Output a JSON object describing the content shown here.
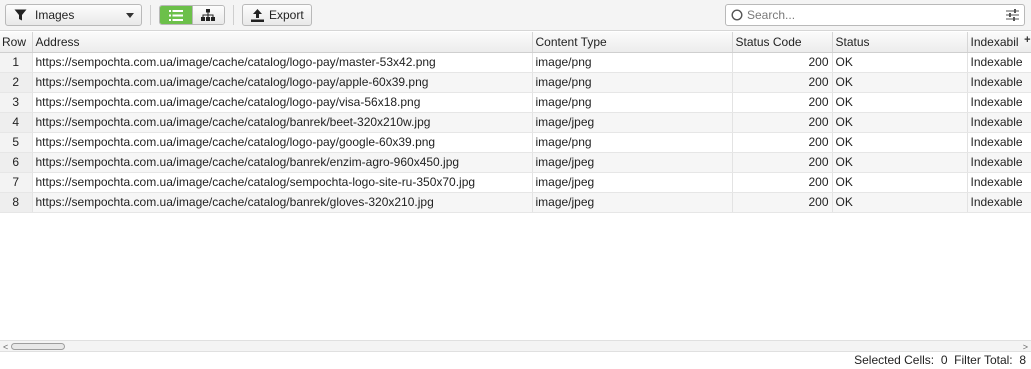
{
  "toolbar": {
    "filter": {
      "selected": "Images"
    },
    "view_toggle": {
      "icons": [
        "list-view-icon",
        "tree-view-icon"
      ],
      "active": "list-view-icon"
    },
    "export_label": "Export",
    "search": {
      "placeholder": "Search...",
      "value": ""
    }
  },
  "table": {
    "columns": [
      "Row",
      "Address",
      "Content Type",
      "Status Code",
      "Status",
      "Indexabil"
    ],
    "rows": [
      {
        "row": "1",
        "address": "https://sempochta.com.ua/image/cache/catalog/logo-pay/master-53x42.png",
        "content_type": "image/png",
        "status_code": "200",
        "status": "OK",
        "indexability": "Indexable"
      },
      {
        "row": "2",
        "address": "https://sempochta.com.ua/image/cache/catalog/logo-pay/apple-60x39.png",
        "content_type": "image/png",
        "status_code": "200",
        "status": "OK",
        "indexability": "Indexable"
      },
      {
        "row": "3",
        "address": "https://sempochta.com.ua/image/cache/catalog/logo-pay/visa-56x18.png",
        "content_type": "image/png",
        "status_code": "200",
        "status": "OK",
        "indexability": "Indexable"
      },
      {
        "row": "4",
        "address": "https://sempochta.com.ua/image/cache/catalog/banrek/beet-320x210w.jpg",
        "content_type": "image/jpeg",
        "status_code": "200",
        "status": "OK",
        "indexability": "Indexable"
      },
      {
        "row": "5",
        "address": "https://sempochta.com.ua/image/cache/catalog/logo-pay/google-60x39.png",
        "content_type": "image/png",
        "status_code": "200",
        "status": "OK",
        "indexability": "Indexable"
      },
      {
        "row": "6",
        "address": "https://sempochta.com.ua/image/cache/catalog/banrek/enzim-agro-960x450.jpg",
        "content_type": "image/jpeg",
        "status_code": "200",
        "status": "OK",
        "indexability": "Indexable"
      },
      {
        "row": "7",
        "address": "https://sempochta.com.ua/image/cache/catalog/sempochta-logo-site-ru-350x70.jpg",
        "content_type": "image/jpeg",
        "status_code": "200",
        "status": "OK",
        "indexability": "Indexable"
      },
      {
        "row": "8",
        "address": "https://sempochta.com.ua/image/cache/catalog/banrek/gloves-320x210.jpg",
        "content_type": "image/jpeg",
        "status_code": "200",
        "status": "OK",
        "indexability": "Indexable"
      }
    ]
  },
  "statusbar": {
    "selected_cells_label": "Selected Cells:",
    "selected_cells": "0",
    "filter_total_label": "Filter Total:",
    "filter_total": "8"
  },
  "colors": {
    "active_toggle": "#6cc04a"
  }
}
